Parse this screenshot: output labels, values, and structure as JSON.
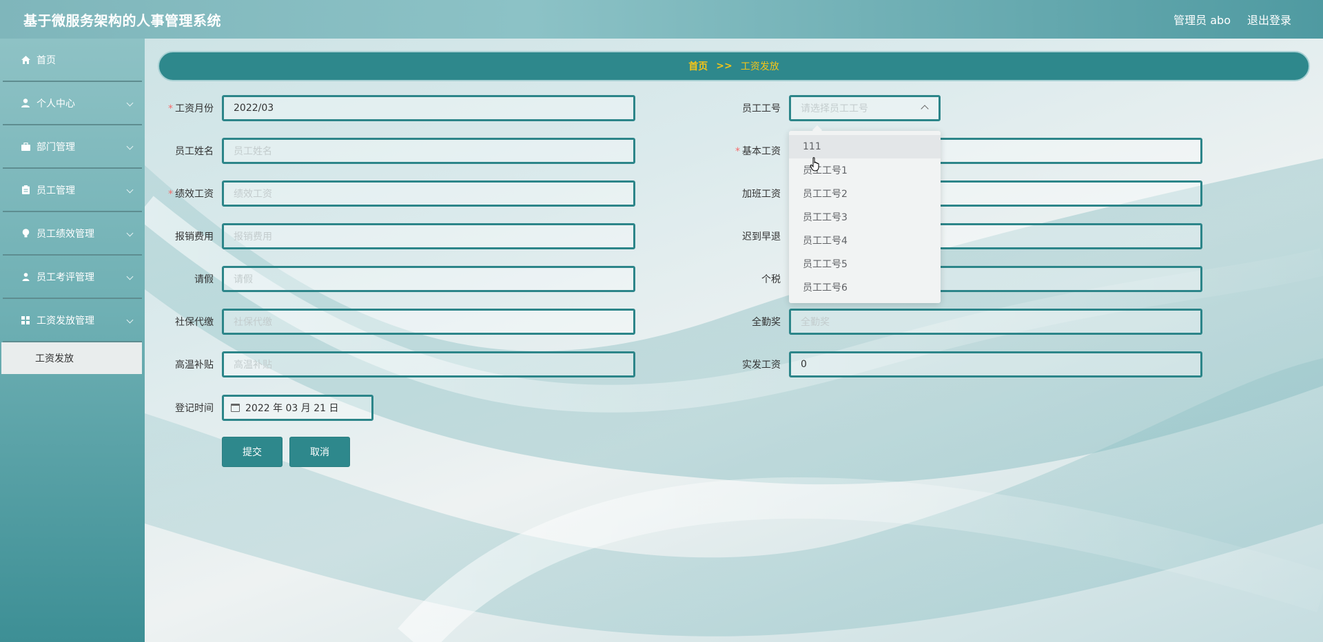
{
  "app": {
    "title": "基于微服务架构的人事管理系统"
  },
  "header": {
    "user_label": "管理员 abo",
    "logout": "退出登录"
  },
  "sidebar": {
    "items": [
      {
        "label": "首页",
        "icon": "home-icon",
        "has_chevron": false
      },
      {
        "label": "个人中心",
        "icon": "user-icon",
        "has_chevron": true
      },
      {
        "label": "部门管理",
        "icon": "briefcase-icon",
        "has_chevron": true
      },
      {
        "label": "员工管理",
        "icon": "clipboard-icon",
        "has_chevron": true
      },
      {
        "label": "员工绩效管理",
        "icon": "bulb-icon",
        "has_chevron": true
      },
      {
        "label": "员工考评管理",
        "icon": "person-icon",
        "has_chevron": true
      },
      {
        "label": "工资发放管理",
        "icon": "grid-icon",
        "has_chevron": true
      }
    ],
    "active_submenu": "工资发放"
  },
  "breadcrumb": {
    "home": "首页",
    "separator": ">>",
    "current": "工资发放"
  },
  "form": {
    "salary_month": {
      "label": "工资月份",
      "value": "2022/03",
      "required": true
    },
    "employee_id": {
      "label": "员工工号",
      "placeholder": "请选择员工工号"
    },
    "employee_name": {
      "label": "员工姓名",
      "placeholder": "员工姓名"
    },
    "base_salary": {
      "label": "基本工资",
      "required": true
    },
    "performance_pay": {
      "label": "绩效工资",
      "placeholder": "绩效工资",
      "required": true
    },
    "overtime_pay": {
      "label": "加班工资"
    },
    "reimbursement": {
      "label": "报销费用",
      "placeholder": "报销费用"
    },
    "late_early": {
      "label": "迟到早退"
    },
    "leave": {
      "label": "请假",
      "placeholder": "请假"
    },
    "income_tax": {
      "label": "个税"
    },
    "social_insurance": {
      "label": "社保代缴",
      "placeholder": "社保代缴"
    },
    "full_attendance": {
      "label": "全勤奖",
      "placeholder": "全勤奖"
    },
    "heat_allowance": {
      "label": "高温补贴",
      "placeholder": "高温补贴"
    },
    "net_pay": {
      "label": "实发工资",
      "value": "0"
    },
    "register_time": {
      "label": "登记时间",
      "value": "2022 年 03 月 21 日"
    },
    "submit": "提交",
    "cancel": "取消"
  },
  "dropdown": {
    "options": [
      "111",
      "员工工号1",
      "员工工号2",
      "员工工号3",
      "员工工号4",
      "员工工号5",
      "员工工号6"
    ],
    "hover_index": 0
  },
  "colors": {
    "primary": "#2e888c",
    "breadcrumb_text": "#f5c518",
    "required": "#f56c6c"
  }
}
